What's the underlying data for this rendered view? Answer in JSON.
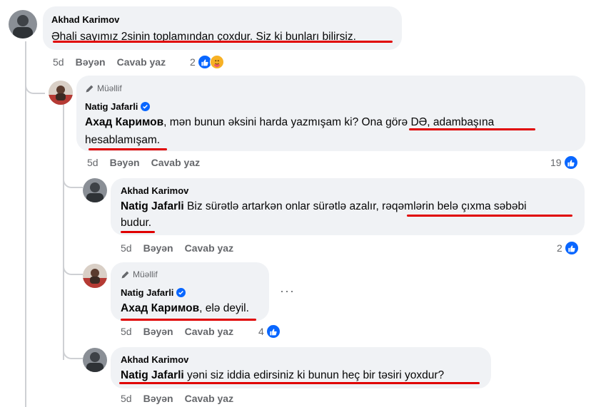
{
  "colors": {
    "bubble": "#f0f2f5",
    "like": "#0866ff",
    "underline": "#e00000",
    "meta": "#65676b"
  },
  "comments": [
    {
      "author": "Akhad Karimov",
      "text": "Əhali sayımız 2sinin toplamından çoxdur. Siz ki bunları bilirsiz.",
      "time": "5d",
      "like": "Bəyən",
      "reply": "Cavab yaz",
      "reactions": "2",
      "reaction_icons": [
        "like-icon",
        "care-icon"
      ]
    },
    {
      "badge": "Müəllif",
      "author": "Natig Jafarli",
      "mention": "Ахад Каримов",
      "text_a": ", mən bunun əksini harda yazmışam ki? Ona görə DƏ, adambaşına",
      "text_b": "hesablamışam.",
      "time": "5d",
      "like": "Bəyən",
      "reply": "Cavab yaz",
      "reactions": "19"
    },
    {
      "author": "Akhad Karimov",
      "mention": "Natig Jafarli",
      "text_a": " Biz sürətlə artarkən onlar sürətlə azalır, rəqəmlərin belə çıxma səbəbi",
      "text_b": "budur.",
      "time": "5d",
      "like": "Bəyən",
      "reply": "Cavab yaz",
      "reactions": "2"
    },
    {
      "badge": "Müəllif",
      "author": "Natig Jafarli",
      "mention": "Ахад Каримов",
      "text": ", elə deyil.",
      "time": "5d",
      "like": "Bəyən",
      "reply": "Cavab yaz",
      "reactions": "4",
      "more": "···"
    },
    {
      "author": "Akhad Karimov",
      "mention": "Natig Jafarli",
      "text": " yəni siz iddia edirsiniz ki bunun heç bir təsiri yoxdur?",
      "time": "5d",
      "like": "Bəyən",
      "reply": "Cavab yaz"
    }
  ]
}
